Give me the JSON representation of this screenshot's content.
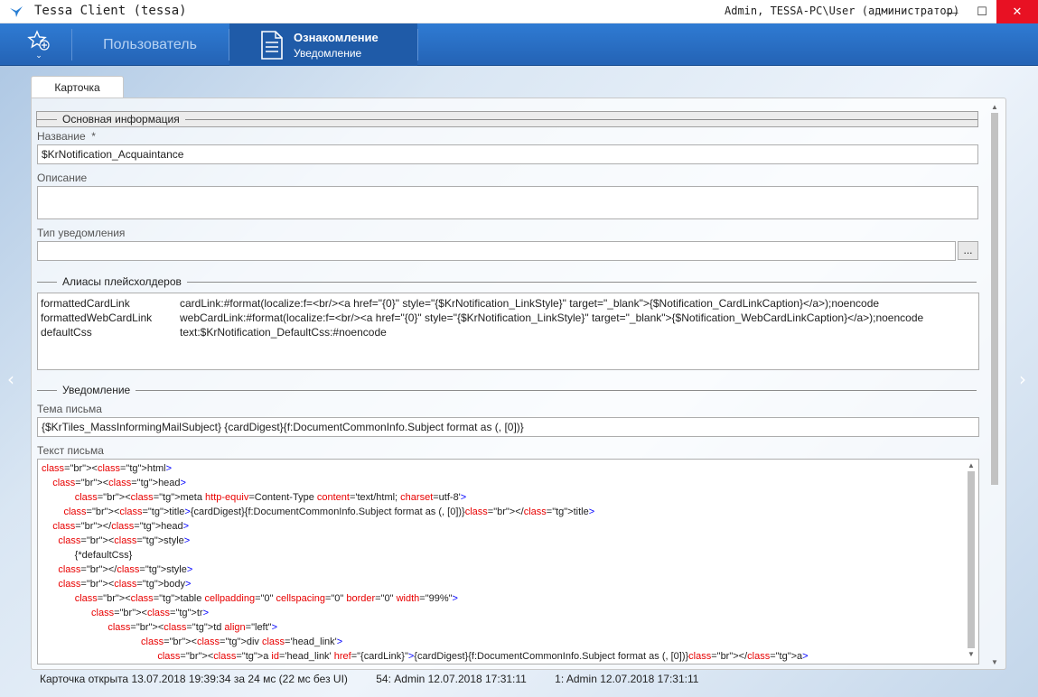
{
  "window": {
    "title": "Tessa Client (tessa)",
    "user": "Admin, TESSA-PC\\User (администратор)",
    "controls": {
      "minimize": "—",
      "maximize": "☐",
      "close": "✕"
    }
  },
  "topbar": {
    "favorites_icon": "star-add-icon",
    "user_tab": "Пользователь",
    "active_tab": {
      "title": "Ознакомление",
      "subtitle": "Уведомление"
    }
  },
  "card": {
    "tab_label": "Карточка"
  },
  "main_info": {
    "section": "Основная информация",
    "name_label": "Название",
    "required": "*",
    "name_value": "$KrNotification_Acquaintance",
    "description_label": "Описание",
    "description_value": "",
    "type_label": "Тип уведомления",
    "type_value": "",
    "type_button": "..."
  },
  "aliases": {
    "section": "Алиасы плейсхолдеров",
    "rows": [
      {
        "key": "formattedCardLink",
        "value": "cardLink:#format(localize:f=<br/><a href=\"{0}\" style=\"{$KrNotification_LinkStyle}\" target=\"_blank\">{$Notification_CardLinkCaption}</a>);noencode"
      },
      {
        "key": "formattedWebCardLink",
        "value": "webCardLink:#format(localize:f=<br/><a href=\"{0}\" style=\"{$KrNotification_LinkStyle}\" target=\"_blank\">{$Notification_WebCardLinkCaption}</a>);noencode"
      },
      {
        "key": "defaultCss",
        "value": "text:$KrNotification_DefaultCss:#noencode"
      }
    ]
  },
  "notification": {
    "section": "Уведомление",
    "subject_label": "Тема письма",
    "subject_value": "{$KrTiles_MassInformingMailSubject} {cardDigest}{f:DocumentCommonInfo.Subject format as (, [0])}",
    "body_label": "Текст письма",
    "body_lines": [
      "<html>",
      "    <head>",
      "            <meta http-equiv=Content-Type content='text/html; charset=utf-8'>",
      "        <title>{cardDigest}{f:DocumentCommonInfo.Subject format as (, [0])}</title>",
      "    </head>",
      "      <style>",
      "            {*defaultCss}",
      "      </style>",
      "      <body>",
      "            <table cellpadding=\"0\" cellspacing=\"0\" border=\"0\" width=\"99%\">",
      "                  <tr>",
      "                        <td align=\"left\">",
      "                                    <div class='head_link'>",
      "                                          <a id='head_link' href=\"{cardLink}\">{cardDigest}{f:DocumentCommonInfo.Subject format as (, [0])}</a>"
    ]
  },
  "status": {
    "opened": "Карточка открыта 13.07.2018 19:39:34 за 24 мс (22 мс без UI)",
    "version": "54:  Admin  12.07.2018 17:31:11",
    "created": "1:  Admin  12.07.2018 17:31:11"
  }
}
